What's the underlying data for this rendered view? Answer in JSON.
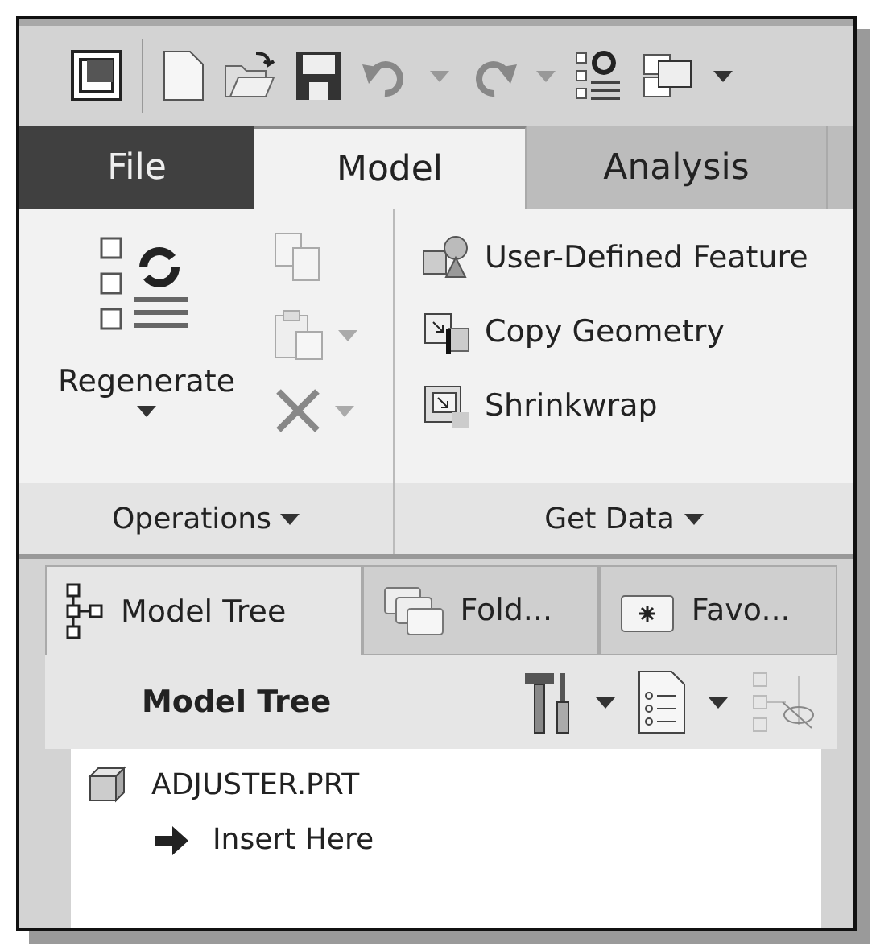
{
  "ribbon_tabs": [
    {
      "label": "File",
      "kind": "file",
      "selected": false
    },
    {
      "label": "Model",
      "kind": "tab",
      "selected": true
    },
    {
      "label": "Analysis",
      "kind": "tab",
      "selected": false
    }
  ],
  "operations": {
    "regenerate": "Regenerate",
    "label": "Operations"
  },
  "get_data": {
    "items": [
      "User-Defined Feature",
      "Copy Geometry",
      "Shrinkwrap"
    ],
    "label": "Get Data"
  },
  "panel_tabs": [
    {
      "label": "Model Tree",
      "selected": true
    },
    {
      "label": "Fold...",
      "selected": false
    },
    {
      "label": "Favo...",
      "selected": false
    }
  ],
  "panel": {
    "title": "Model Tree"
  },
  "tree": [
    {
      "label": "ADJUSTER.PRT",
      "kind": "part",
      "children": [
        {
          "label": "Insert Here",
          "kind": "insert"
        }
      ]
    }
  ]
}
